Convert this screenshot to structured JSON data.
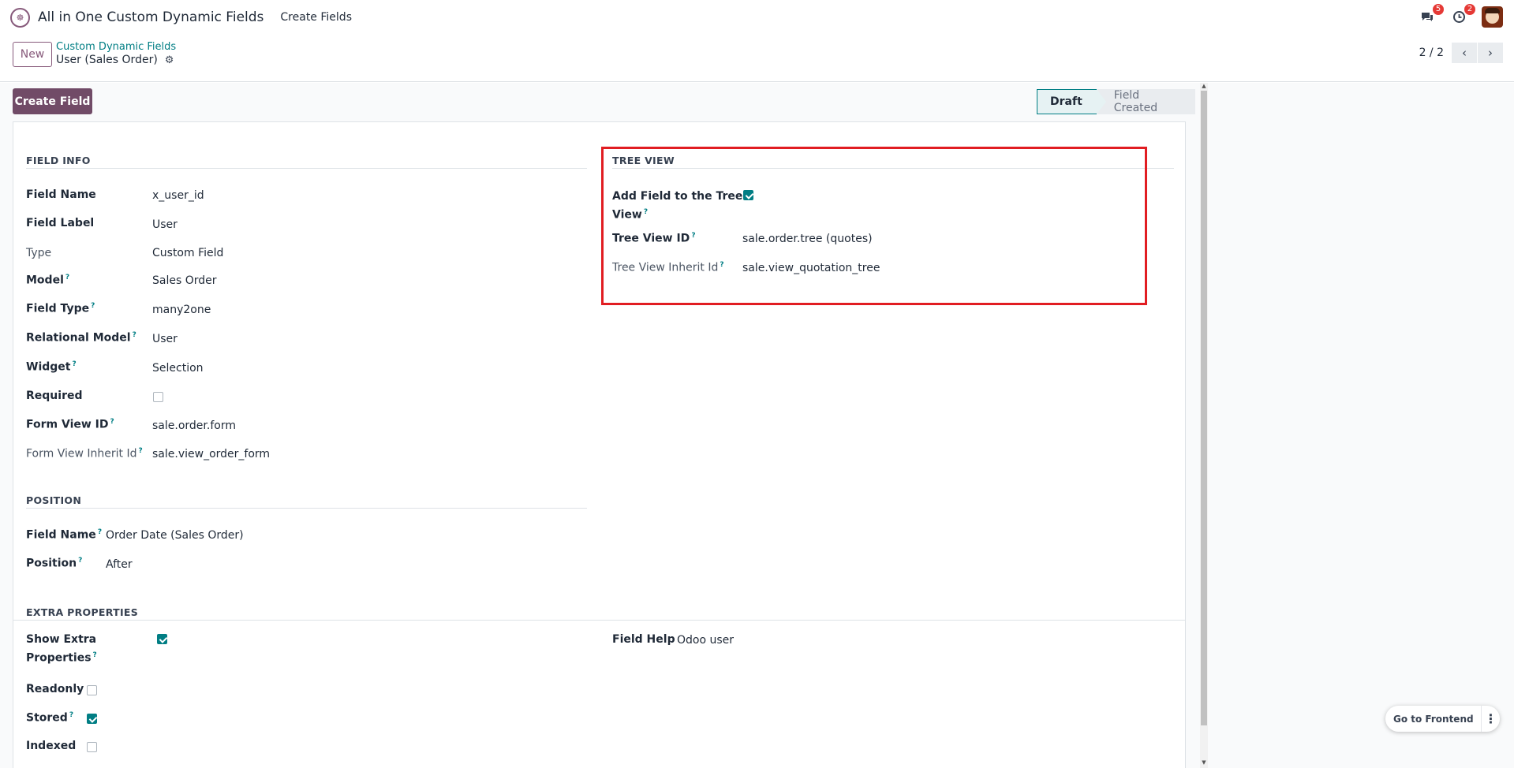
{
  "navbar": {
    "app_name": "All in One Custom Dynamic Fields",
    "menu_item": "Create Fields",
    "messages_badge": "5",
    "activities_badge": "2"
  },
  "control_panel": {
    "new_label": "New",
    "breadcrumb_parent": "Custom Dynamic Fields",
    "breadcrumb_current": "User (Sales Order)",
    "pager_value": "2 / 2"
  },
  "header": {
    "create_field_label": "Create Field",
    "status_steps": [
      "Draft",
      "Field Created"
    ],
    "active_status": "Draft"
  },
  "field_info": {
    "title": "FIELD INFO",
    "rows": [
      {
        "label": "Field Name",
        "value": "x_user_id"
      },
      {
        "label": "Field Label",
        "value": "User"
      },
      {
        "label": "Type",
        "value": "Custom Field"
      },
      {
        "label": "Model",
        "value": "Sales Order"
      },
      {
        "label": "Field Type",
        "value": "many2one"
      },
      {
        "label": "Relational Model",
        "value": "User"
      },
      {
        "label": "Widget",
        "value": "Selection"
      },
      {
        "label": "Required",
        "value": false
      },
      {
        "label": "Form View ID",
        "value": "sale.order.form"
      },
      {
        "label": "Form View Inherit Id",
        "value": "sale.view_order_form"
      }
    ]
  },
  "tree_view": {
    "title": "TREE VIEW",
    "add_field_label_1": "Add Field to the Tree",
    "add_field_label_2": "View",
    "add_field_checked": true,
    "tree_view_id_label": "Tree View ID",
    "tree_view_id_value": "sale.order.tree (quotes)",
    "tree_inherit_label": "Tree View Inherit Id",
    "tree_inherit_value": "sale.view_quotation_tree"
  },
  "position": {
    "title": "POSITION",
    "field_name_label": "Field Name",
    "field_name_value": "Order Date (Sales Order)",
    "position_label": "Position",
    "position_value": "After"
  },
  "extra_properties": {
    "title": "EXTRA PROPERTIES",
    "show_extra_label_1": "Show Extra",
    "show_extra_label_2": "Properties",
    "show_extra_checked": true,
    "readonly_label": "Readonly",
    "readonly_checked": false,
    "stored_label": "Stored",
    "stored_checked": true,
    "indexed_label": "Indexed",
    "indexed_checked": false,
    "field_help_label": "Field Help",
    "field_help_value": "Odoo user"
  },
  "floating": {
    "go_frontend_label": "Go to Frontend"
  },
  "icons": {
    "app_logo": "app-logo-icon",
    "messages": "chat-icon",
    "activities": "clock-icon",
    "settings": "gear-icon",
    "pager_prev": "chevron-left-icon",
    "pager_next": "chevron-right-icon",
    "help": "question-mark-icon",
    "more": "kebab-icon"
  },
  "colors": {
    "primary": "#714b67",
    "accent": "#017e84",
    "badge": "#e53935",
    "highlight": "#e11d22"
  }
}
